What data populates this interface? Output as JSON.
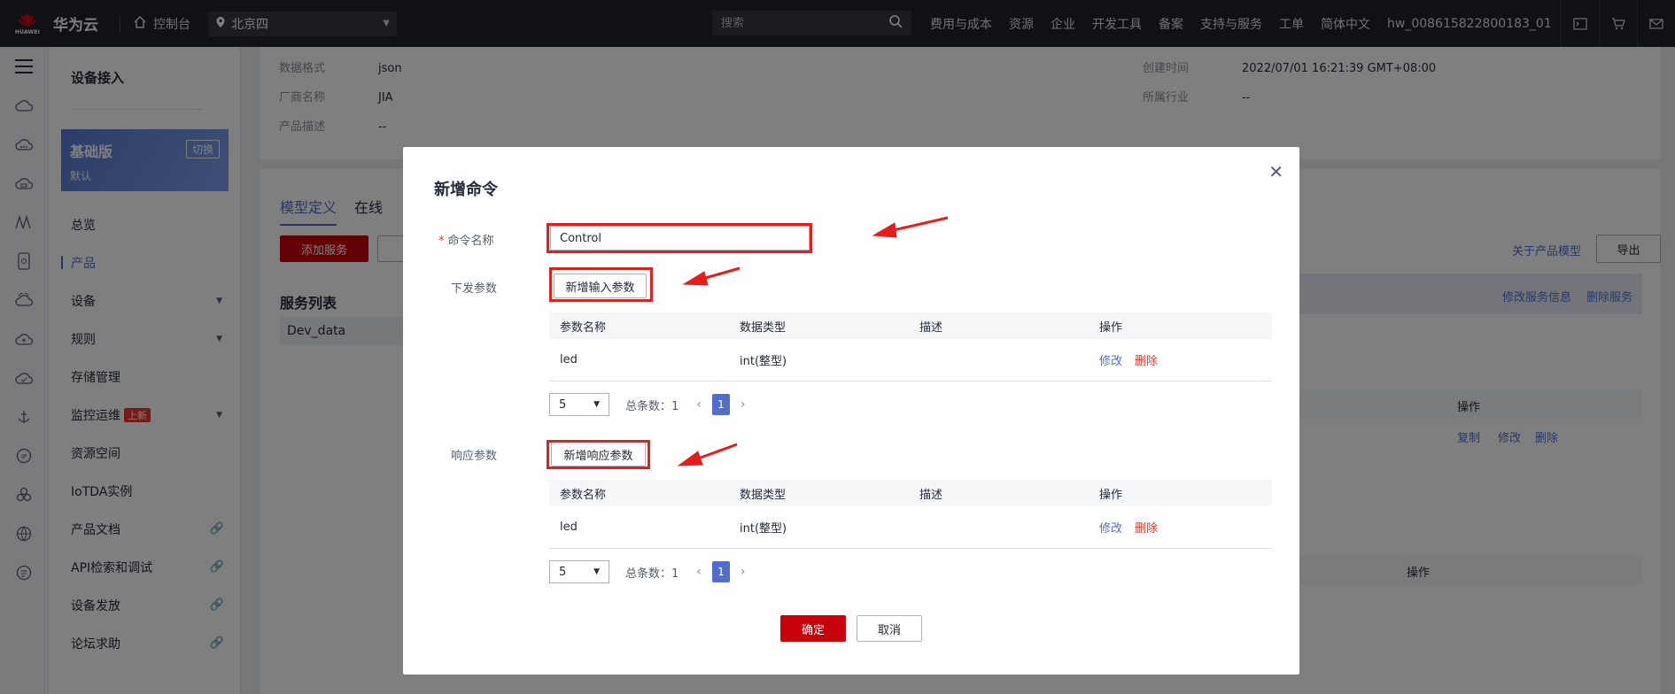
{
  "topbar": {
    "logo_text": "HUAWEI",
    "brand": "华为云",
    "console": "控制台",
    "region": "北京四",
    "search_placeholder": "搜索",
    "nav": [
      "费用与成本",
      "资源",
      "企业",
      "开发工具",
      "备案",
      "支持与服务",
      "工单",
      "简体中文",
      "hw_008615822800183_01"
    ]
  },
  "sidebar": {
    "title": "设备接入",
    "edition_name": "基础版",
    "edition_switch": "切换",
    "edition_desc": "默认",
    "items": [
      {
        "label": "总览"
      },
      {
        "label": "产品"
      },
      {
        "label": "设备"
      },
      {
        "label": "规则"
      },
      {
        "label": "存储管理"
      },
      {
        "label": "监控运维",
        "badge": "上新"
      },
      {
        "label": "资源空间"
      },
      {
        "label": "IoTDA实例"
      },
      {
        "label": "产品文档"
      },
      {
        "label": "API检索和调试"
      },
      {
        "label": "设备发放"
      },
      {
        "label": "论坛求助"
      }
    ]
  },
  "product_info": {
    "format_label": "数据格式",
    "format_value": "json",
    "vendor_label": "厂商名称",
    "vendor_value": "JIA",
    "desc_label": "产品描述",
    "desc_value": "--",
    "created_label": "创建时间",
    "created_value": "2022/07/01 16:21:39 GMT+08:00",
    "industry_label": "所属行业",
    "industry_value": "--"
  },
  "background": {
    "tab_model": "模型定义",
    "tab_online": "在线",
    "add_service": "添加服务",
    "about_model": "关于产品模型",
    "export": "导出",
    "service_list": "服务列表",
    "service_item": "Dev_data",
    "edit_service": "修改服务信息",
    "delete_service": "删除服务",
    "ops_header": "操作",
    "op_copy": "复制",
    "op_edit": "修改",
    "op_delete": "删除",
    "ops_header2": "操作"
  },
  "dialog": {
    "title": "新增命令",
    "command_name_label": "命令名称",
    "command_name_value": "Control",
    "down_params_label": "下发参数",
    "add_input_param": "新增输入参数",
    "response_params_label": "响应参数",
    "add_response_param": "新增响应参数",
    "table_headers": [
      "参数名称",
      "数据类型",
      "描述",
      "操作"
    ],
    "input_rows": [
      {
        "name": "led",
        "type": "int(整型)",
        "desc": "",
        "edit": "修改",
        "delete": "删除"
      }
    ],
    "response_rows": [
      {
        "name": "led",
        "type": "int(整型)",
        "desc": "",
        "edit": "修改",
        "delete": "删除"
      }
    ],
    "page_size": "5",
    "total_label": "总条数：1",
    "current_page": "1",
    "ok": "确定",
    "cancel": "取消"
  },
  "colors": {
    "brand_red": "#c7000b",
    "link_blue": "#526ecc",
    "annotation_red": "#e51d1d"
  }
}
